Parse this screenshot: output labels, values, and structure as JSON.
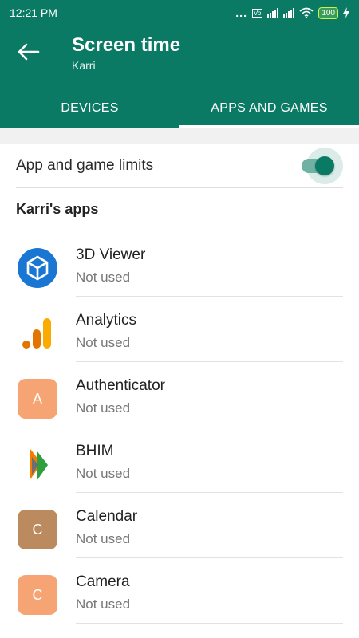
{
  "status_bar": {
    "time": "12:21 PM",
    "dots": "...",
    "network_badge": "Vo",
    "battery": "100"
  },
  "app_bar": {
    "title": "Screen time",
    "subtitle": "Karri",
    "tabs": [
      {
        "label": "DEVICES",
        "selected": false
      },
      {
        "label": "APPS AND GAMES",
        "selected": true
      }
    ]
  },
  "limits": {
    "label": "App and game limits",
    "enabled": true
  },
  "apps_section": {
    "title": "Karri's apps",
    "apps": [
      {
        "name": "3D Viewer",
        "status": "Not used",
        "icon": "cube-icon",
        "color": "#1976d2"
      },
      {
        "name": "Analytics",
        "status": "Not used",
        "icon": "analytics-icon",
        "color": "#f9ab00"
      },
      {
        "name": "Authenticator",
        "status": "Not used",
        "icon": "letter-icon",
        "letter": "A",
        "color": "#f6a474"
      },
      {
        "name": "BHIM",
        "status": "Not used",
        "icon": "bhim-icon",
        "color": "#f57c00"
      },
      {
        "name": "Calendar",
        "status": "Not used",
        "icon": "letter-icon",
        "letter": "C",
        "color": "#bb8a5f"
      },
      {
        "name": "Camera",
        "status": "Not used",
        "icon": "letter-icon",
        "letter": "C",
        "color": "#f6a474"
      }
    ]
  },
  "colors": {
    "primary": "#0a7a64",
    "toggle_track": "#6fb2a4",
    "section_gap": "#f1f1f1"
  }
}
